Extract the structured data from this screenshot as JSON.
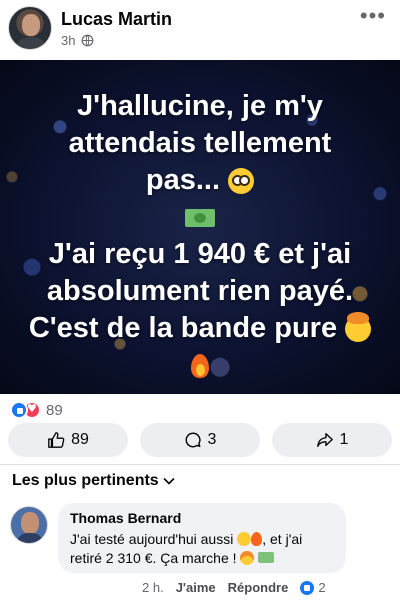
{
  "post": {
    "author": "Lucas Martin",
    "time": "3h",
    "privacy_icon": "globe-icon",
    "menu_icon": "more-options-icon",
    "image_text": {
      "line1": "J'hallucine, je m'y",
      "line2": "attendais tellement",
      "line3": "pas...",
      "line5": "J'ai reçu 1 940 € et j'ai",
      "line6": "absolument rien payé.",
      "line7": "C'est de la bande pure"
    },
    "reactions": {
      "types": [
        "like",
        "love"
      ],
      "count": "89"
    },
    "actions": {
      "like_count": "89",
      "comment_count": "3",
      "share_count": "1"
    }
  },
  "comments": {
    "sort_label": "Les plus pertinents",
    "items": [
      {
        "author": "Thomas Bernard",
        "text_part1": "J'ai testé aujourd'hui aussi ",
        "text_part2": ", et j'ai",
        "text_part3": "retiré 2 310 €. Ça marche ! ",
        "time": "2 h.",
        "like_label": "J'aime",
        "reply_label": "Répondre",
        "reaction_count": "2"
      }
    ]
  },
  "colors": {
    "brand_blue": "#1877f2",
    "love_red": "#f33e58",
    "secondary_text": "#65676b",
    "button_bg": "#eceef1"
  }
}
